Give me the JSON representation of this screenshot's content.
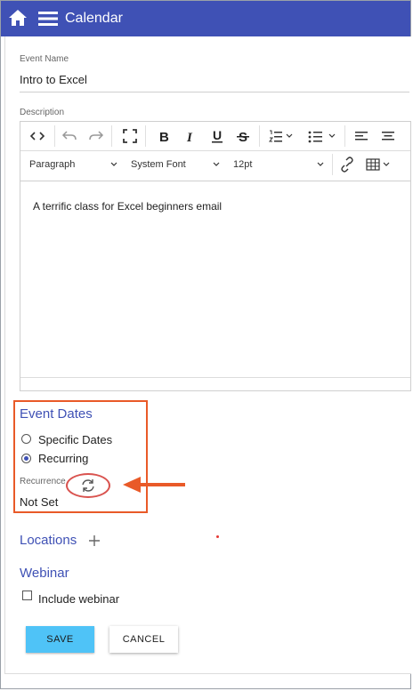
{
  "app": {
    "title": "Calendar"
  },
  "form": {
    "event_name_label": "Event Name",
    "event_name_value": "Intro to Excel",
    "description_label": "Description"
  },
  "editor": {
    "format_select": "Paragraph",
    "font_select": "System Font",
    "size_select": "12pt",
    "content": "A terrific class for Excel beginners email",
    "toolbar_icons": [
      "source-code-icon",
      "undo-icon",
      "redo-icon",
      "fullscreen-icon",
      "bold-icon",
      "italic-icon",
      "underline-icon",
      "strikethrough-icon",
      "numbered-list-icon",
      "bulleted-list-icon",
      "align-left-icon",
      "align-center-icon",
      "link-icon",
      "table-icon"
    ]
  },
  "event_dates": {
    "title": "Event Dates",
    "option_specific": "Specific Dates",
    "option_recurring": "Recurring",
    "selected": "Recurring",
    "recurrence_label": "Recurrence",
    "recurrence_value": "Not Set"
  },
  "locations": {
    "title": "Locations"
  },
  "webinar": {
    "title": "Webinar",
    "checkbox_label": "Include webinar",
    "checked": false
  },
  "actions": {
    "save": "SAVE",
    "cancel": "CANCEL"
  },
  "colors": {
    "header": "#3f51b5",
    "accent": "#3f51b5",
    "save_button": "#4fc3f7",
    "highlight": "#e95a28"
  }
}
